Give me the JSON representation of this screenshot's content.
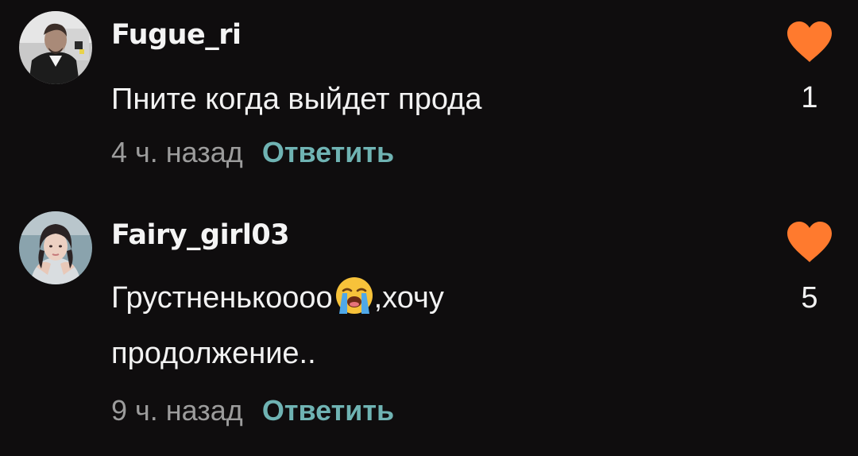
{
  "colors": {
    "background": "#0f0d0e",
    "text": "#f2f2f2",
    "muted": "#9c9c9c",
    "reply": "#6fb3b3",
    "heart": "#ff7a2e"
  },
  "comments": [
    {
      "username": "Fugue_ri",
      "avatar_icon": "user-avatar-man-in-suit",
      "text_line_1": "Пните когда выйдет прода",
      "time": "4 ч. назад",
      "reply_label": "Ответить",
      "like_icon": "heart-icon",
      "likes": "1"
    },
    {
      "username": "Fairy_girl03",
      "avatar_icon": "user-avatar-girl",
      "text_before_emoji": "Грустненькоооо",
      "emoji": "loudly-crying-face-emoji",
      "text_after_emoji": ",хочу",
      "text_line_2": "продолжение..",
      "time": "9 ч. назад",
      "reply_label": "Ответить",
      "like_icon": "heart-icon",
      "likes": "5"
    }
  ]
}
